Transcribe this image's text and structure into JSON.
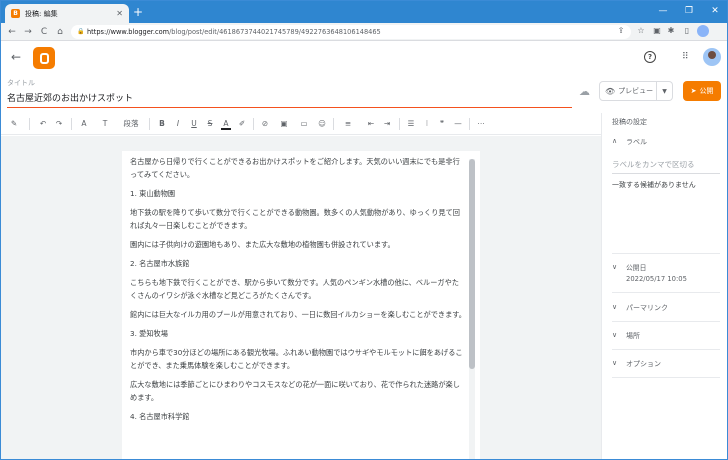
{
  "browser": {
    "tab_title": "投稿: 編集",
    "tab_close": "✕",
    "new_tab": "+",
    "window_controls": [
      "—",
      "❐",
      "✕"
    ],
    "url_host": "https://www.blogger.com",
    "url_path": "/blog/post/edit/4618673744021745789/4922763648106148465",
    "nav": {
      "back": "←",
      "forward": "→",
      "reload": "C",
      "home": "⌂"
    }
  },
  "header": {
    "back_icon": "←",
    "help_icon": "?",
    "apps_icon": "⋮⋮⋮"
  },
  "editor": {
    "title_label": "タイトル",
    "title_value": "名古屋近郊のお出かけスポット",
    "preview_label": "プレビュー",
    "publish_label": "公開",
    "toolbar": {
      "format": "段落",
      "items": [
        "✎",
        "↶",
        "↷",
        "A",
        "T",
        "B",
        "I",
        "U",
        "S",
        "A",
        "✐",
        "⊘",
        "▣",
        "▭",
        "☺",
        "≡",
        "⇤",
        "⇥",
        "☰",
        "⁝",
        "❞",
        "—",
        "⋯"
      ]
    },
    "paragraphs": [
      "名古屋から日帰りで行くことができるお出かけスポットをご紹介します。天気のいい週末にでも是非行ってみてください。",
      "1. 東山動物園",
      "地下鉄の駅を降りて歩いて数分で行くことができる動物園。数多くの人気動物があり、ゆっくり見て回れば丸々一日楽しむことができます。",
      "園内には子供向けの遊園地もあり、また広大な敷地の植物園も併設されています。",
      "2. 名古屋市水族館",
      "こちらも地下鉄で行くことができ、駅から歩いて数分です。人気のペンギン水槽の他に、ベルーガやたくさんのイワシが泳ぐ水槽など見どころがたくさんです。",
      "館内には巨大なイルカ用のプールが用意されており、一日に数回イルカショーを楽しむことができます。",
      "3. 愛知牧場",
      "市内から車で30分ほどの場所にある観光牧場。ふれあい動物園ではウサギやモルモットに餌をあげることができ、また乗馬体験を楽しむことができます。",
      "広大な敷地には季節ごとにひまわりやコスモスなどの花が一面に咲いており、花で作られた迷路が楽しめます。",
      "4. 名古屋市科学館"
    ]
  },
  "sidebar": {
    "settings_title": "投稿の設定",
    "label_section": "ラベル",
    "label_placeholder": "ラベルをカンマで区切る",
    "no_match": "一致する候補がありません",
    "publish_date_title": "公開日",
    "publish_date_value": "2022/05/17 10:05",
    "permalink": "パーマリンク",
    "location": "場所",
    "options": "オプション",
    "chev_up": "∧",
    "chev_down": "∨"
  },
  "colors": {
    "accent": "#f57c00",
    "titlebar": "#2f86d0"
  }
}
